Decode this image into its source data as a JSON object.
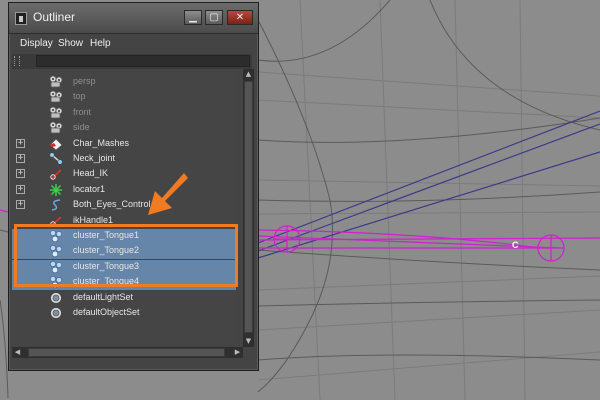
{
  "window": {
    "title": "Outliner"
  },
  "title_buttons": {
    "minimize": "▁",
    "maximize": "▢",
    "close": "✕"
  },
  "menu": [
    "Display",
    "Show",
    "Help"
  ],
  "filter": {
    "value": ""
  },
  "nodes": [
    {
      "label": "persp",
      "icon": "camera-icon",
      "dim": true,
      "expandable": false,
      "selected": false
    },
    {
      "label": "top",
      "icon": "camera-icon",
      "dim": true,
      "expandable": false,
      "selected": false
    },
    {
      "label": "front",
      "icon": "camera-icon",
      "dim": true,
      "expandable": false,
      "selected": false
    },
    {
      "label": "side",
      "icon": "camera-icon",
      "dim": true,
      "expandable": false,
      "selected": false
    },
    {
      "label": "Char_Mashes",
      "icon": "mesh-group-icon",
      "dim": false,
      "expandable": true,
      "selected": false
    },
    {
      "label": "Neck_joint",
      "icon": "joint-icon",
      "dim": false,
      "expandable": true,
      "selected": false
    },
    {
      "label": "Head_IK",
      "icon": "ik-handle-icon",
      "dim": false,
      "expandable": true,
      "selected": false
    },
    {
      "label": "locator1",
      "icon": "locator-icon",
      "dim": false,
      "expandable": true,
      "selected": false
    },
    {
      "label": "Both_Eyes_Control",
      "icon": "curve-icon",
      "dim": false,
      "expandable": true,
      "selected": false
    },
    {
      "label": "ikHandle1",
      "icon": "ik-handle-icon",
      "dim": false,
      "expandable": false,
      "selected": false
    },
    {
      "label": "cluster_Tongue1",
      "icon": "cluster-icon",
      "dim": false,
      "expandable": false,
      "selected": true
    },
    {
      "label": "cluster_Tongue2",
      "icon": "cluster-icon",
      "dim": false,
      "expandable": false,
      "selected": true
    },
    {
      "label": "cluster_Tongue3",
      "icon": "cluster-icon",
      "dim": false,
      "expandable": false,
      "selected": true
    },
    {
      "label": "cluster_Tongue4",
      "icon": "cluster-icon",
      "dim": false,
      "expandable": false,
      "selected": true
    },
    {
      "label": "defaultLightSet",
      "icon": "set-icon",
      "dim": false,
      "expandable": false,
      "selected": false
    },
    {
      "label": "defaultObjectSet",
      "icon": "set-icon",
      "dim": false,
      "expandable": false,
      "selected": false
    }
  ],
  "viewport": {
    "cluster_marker": "C"
  },
  "colors": {
    "selection": "#6586a8",
    "callout": "#f07b22",
    "rig_curve": "#d020d0",
    "wire": "#3a3a8a"
  }
}
